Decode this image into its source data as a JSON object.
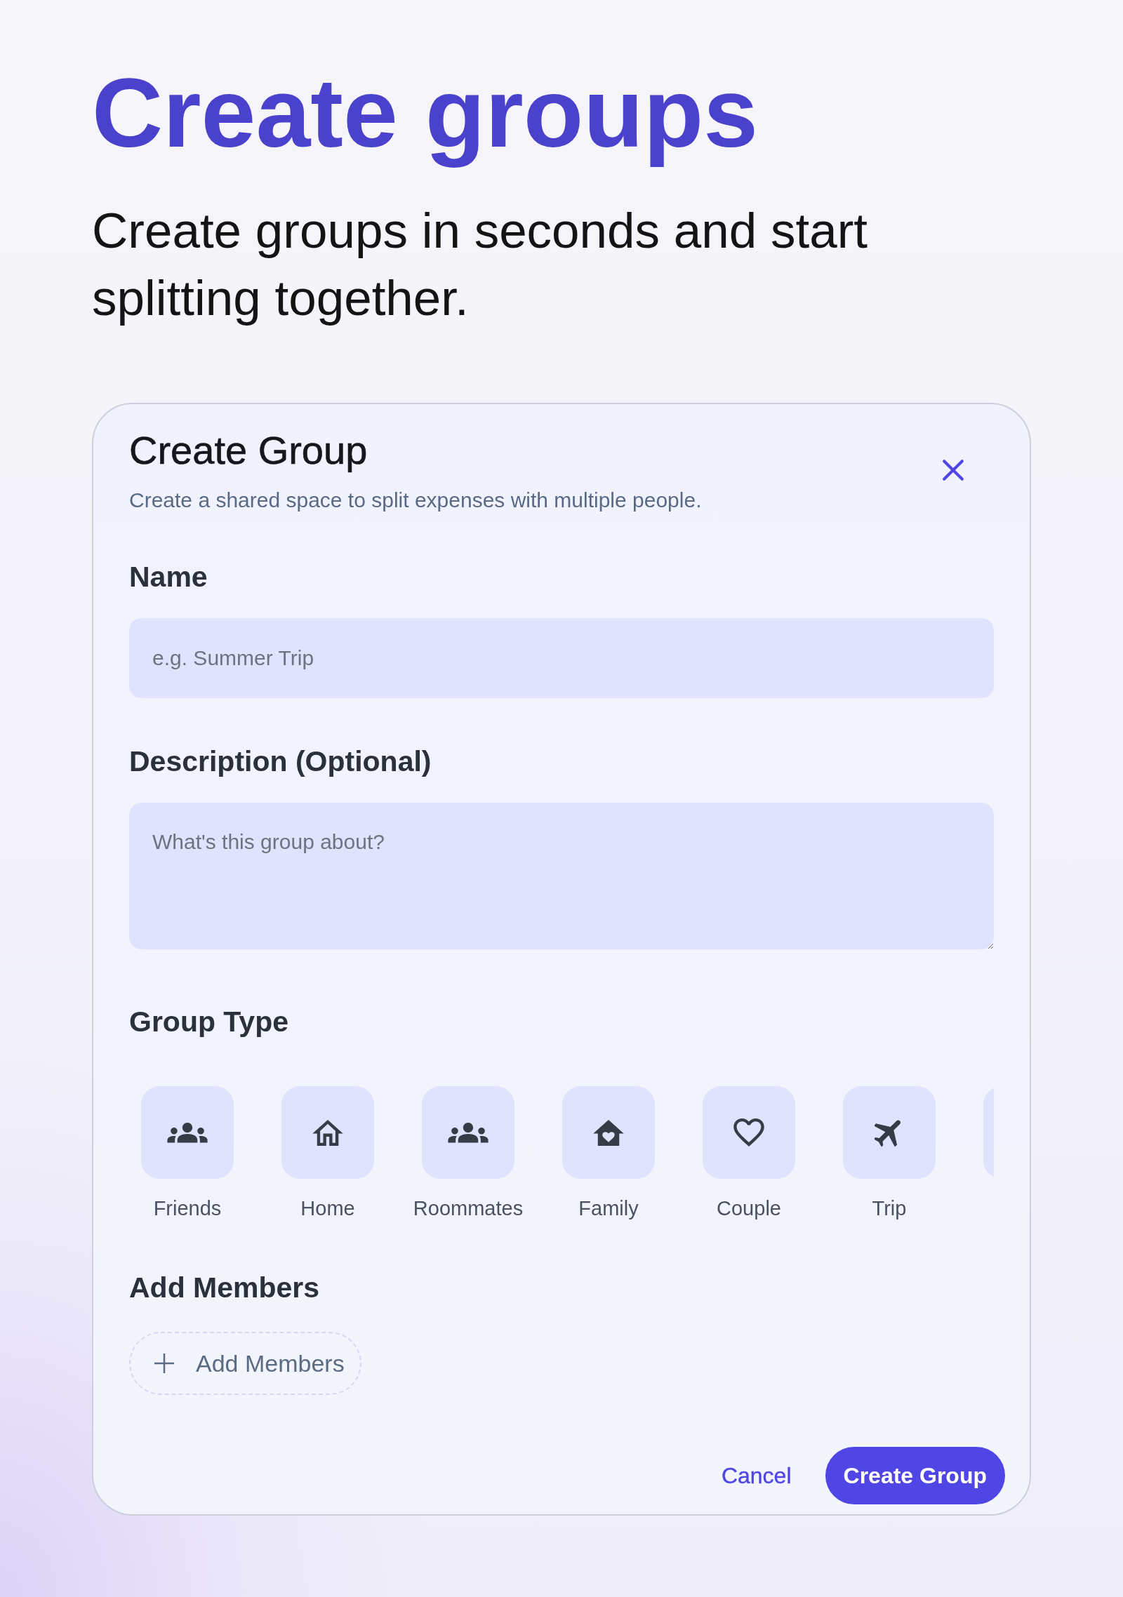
{
  "hero": {
    "title": "Create groups",
    "subtitle": "Create groups in seconds and start splitting together."
  },
  "dialog": {
    "title": "Create Group",
    "subtitle": "Create a shared space to split expenses with multiple people.",
    "fields": [
      {
        "kind": "input",
        "label": "Name",
        "placeholder": "e.g. Summer Trip"
      },
      {
        "kind": "textarea",
        "label": "Description (Optional)",
        "placeholder": "What's this group about?"
      }
    ],
    "group_type": {
      "label": "Group Type",
      "options": [
        {
          "kind": "option",
          "label": "Friends",
          "selected": false
        },
        {
          "kind": "option",
          "label": "Home",
          "selected": false
        },
        {
          "kind": "option",
          "label": "Roommates",
          "selected": false
        },
        {
          "kind": "option",
          "label": "Family",
          "selected": false
        },
        {
          "kind": "option",
          "label": "Couple",
          "selected": false
        },
        {
          "kind": "option",
          "label": "Trip",
          "selected": false
        },
        {
          "kind": "clipped",
          "selected": false
        }
      ]
    },
    "members": {
      "label": "Add Members",
      "button": "Add Members"
    },
    "actions": {
      "cancel": "Cancel",
      "submit": "Create Group"
    }
  }
}
